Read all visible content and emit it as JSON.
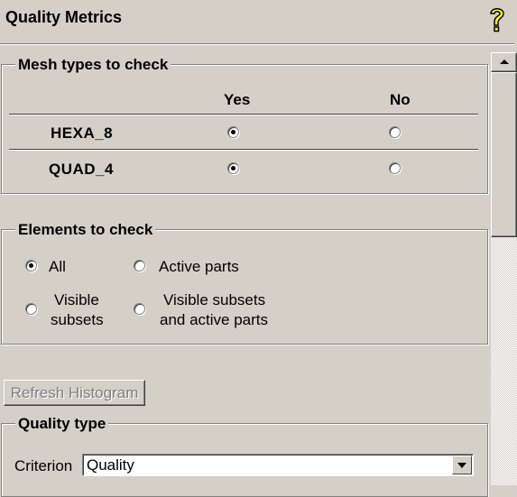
{
  "panel": {
    "title": "Quality Metrics",
    "help_icon": "help-question-icon"
  },
  "mesh_types": {
    "legend": "Mesh types to check",
    "columns": [
      "Yes",
      "No"
    ],
    "rows": [
      {
        "label": "HEXA_8",
        "selected": "Yes"
      },
      {
        "label": "QUAD_4",
        "selected": "Yes"
      }
    ]
  },
  "elements": {
    "legend": "Elements to check",
    "options": [
      {
        "label": "All",
        "checked": true
      },
      {
        "label": "Active parts",
        "checked": false
      },
      {
        "label_line1": "Visible",
        "label_line2": "subsets",
        "checked": false
      },
      {
        "label_line1": "Visible subsets",
        "label_line2": "and active parts",
        "checked": false
      }
    ]
  },
  "refresh_button": {
    "label": "Refresh Histogram",
    "enabled": false
  },
  "quality_type": {
    "legend": "Quality type",
    "criterion_label": "Criterion",
    "criterion_value": "Quality"
  },
  "colors": {
    "background": "#d4d0c8",
    "disabled_text": "#808080"
  }
}
